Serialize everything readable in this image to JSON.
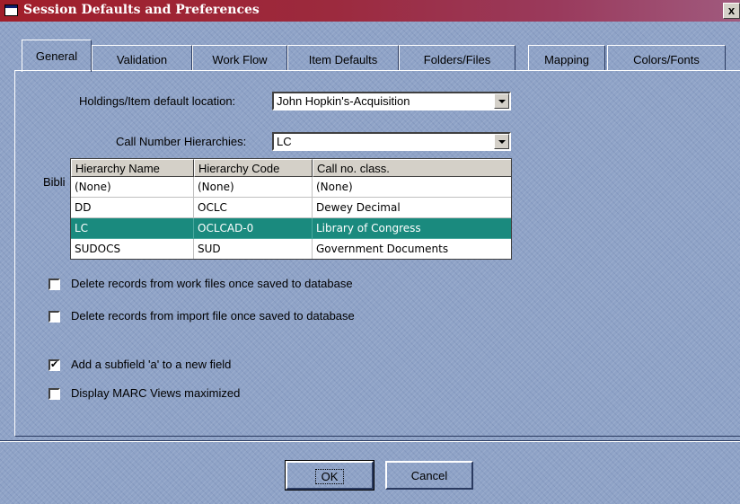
{
  "window": {
    "title": "Session Defaults and Preferences",
    "close_label": "x"
  },
  "tabs": [
    {
      "label": "General",
      "active": true
    },
    {
      "label": "Validation"
    },
    {
      "label": "Work Flow"
    },
    {
      "label": "Item Defaults"
    },
    {
      "label": "Folders/Files"
    },
    {
      "label": "Mapping"
    },
    {
      "label": "Colors/Fonts"
    }
  ],
  "general": {
    "holdings_label": "Holdings/Item default location:",
    "holdings_value": "John Hopkin's-Acquisition",
    "callnum_label": "Call Number Hierarchies:",
    "callnum_value": "LC",
    "obscured_label": "Bibli",
    "hierarchy_table": {
      "columns": [
        "Hierarchy Name",
        "Hierarchy Code",
        "Call no. class."
      ],
      "rows": [
        [
          "(None)",
          "(None)",
          "(None)"
        ],
        [
          "DD",
          "OCLC",
          "Dewey Decimal"
        ],
        [
          "LC",
          "OCLCAD-0",
          "Library of Congress"
        ],
        [
          "SUDOCS",
          "SUD",
          "Government Documents"
        ]
      ],
      "selected_row": 2
    },
    "options": [
      {
        "label": "Delete records from work files once saved to database",
        "checked": false
      },
      {
        "label": "Delete records from import file once saved to database",
        "checked": false
      },
      {
        "label": "Add a subfield 'a' to a new field",
        "checked": true
      },
      {
        "label": "Display MARC Views maximized",
        "checked": false
      }
    ]
  },
  "buttons": {
    "ok": "OK",
    "cancel": "Cancel"
  }
}
